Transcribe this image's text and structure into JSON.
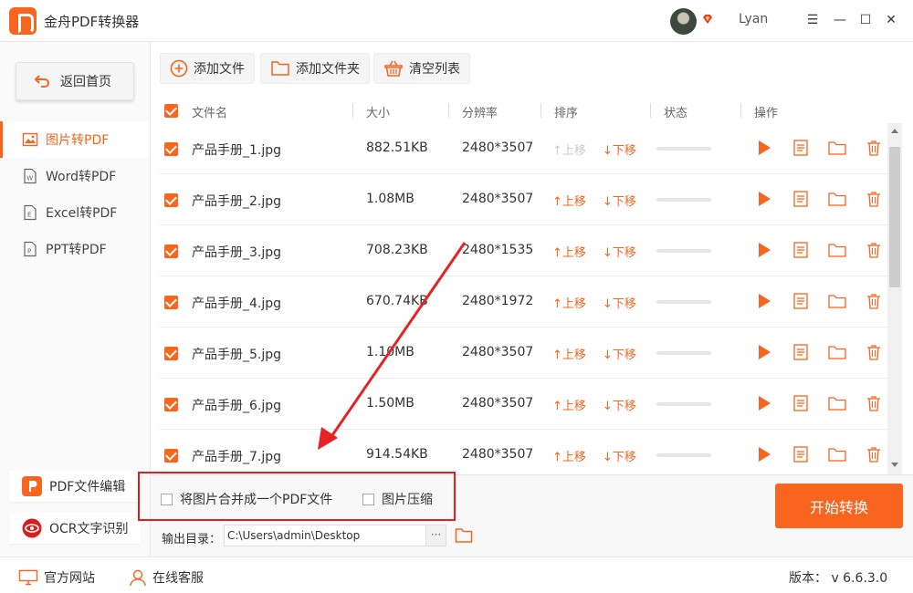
{
  "app": {
    "title": "金舟PDF转换器",
    "username": "Lyan",
    "accent": "#f7651e"
  },
  "window_controls": {
    "menu": "☰",
    "minimize": "—",
    "maximize": "☐",
    "close": "✕"
  },
  "sidebar": {
    "back_label": "返回首页",
    "items": [
      {
        "label": "图片转PDF",
        "icon": "image-icon",
        "active": true
      },
      {
        "label": "Word转PDF",
        "icon": "word-doc-icon",
        "active": false
      },
      {
        "label": "Excel转PDF",
        "icon": "excel-doc-icon",
        "active": false
      },
      {
        "label": "PPT转PDF",
        "icon": "ppt-doc-icon",
        "active": false
      }
    ],
    "tools": [
      {
        "label": "PDF文件编辑",
        "icon": "pdf-edit-icon"
      },
      {
        "label": "OCR文字识别",
        "icon": "ocr-eye-icon"
      }
    ]
  },
  "toolbar": {
    "add_file": "添加文件",
    "add_folder": "添加文件夹",
    "clear_list": "清空列表"
  },
  "table": {
    "headers": {
      "name": "文件名",
      "size": "大小",
      "resolution": "分辨率",
      "order": "排序",
      "status": "状态",
      "actions": "操作"
    },
    "move_up": "上移",
    "move_down": "下移",
    "rows": [
      {
        "name": "产品手册_1.jpg",
        "size": "882.51KB",
        "resolution": "2480*3507",
        "up_disabled": true
      },
      {
        "name": "产品手册_2.jpg",
        "size": "1.08MB",
        "resolution": "2480*3507",
        "up_disabled": false
      },
      {
        "name": "产品手册_3.jpg",
        "size": "708.23KB",
        "resolution": "2480*1535",
        "up_disabled": false
      },
      {
        "name": "产品手册_4.jpg",
        "size": "670.74KB",
        "resolution": "2480*1972",
        "up_disabled": false
      },
      {
        "name": "产品手册_5.jpg",
        "size": "1.10MB",
        "resolution": "2480*3507",
        "up_disabled": false
      },
      {
        "name": "产品手册_6.jpg",
        "size": "1.50MB",
        "resolution": "2480*3507",
        "up_disabled": false
      },
      {
        "name": "产品手册_7.jpg",
        "size": "914.54KB",
        "resolution": "2480*3507",
        "up_disabled": false
      }
    ]
  },
  "options": {
    "merge_label": "将图片合并成一个PDF文件",
    "compress_label": "图片压缩"
  },
  "output": {
    "label": "输出目录：",
    "path": "C:\\Users\\admin\\Desktop",
    "more": "···"
  },
  "start_button": "开始转换",
  "footer": {
    "website": "官方网站",
    "service": "在线客服",
    "version": "版本： v 6.6.3.0"
  }
}
